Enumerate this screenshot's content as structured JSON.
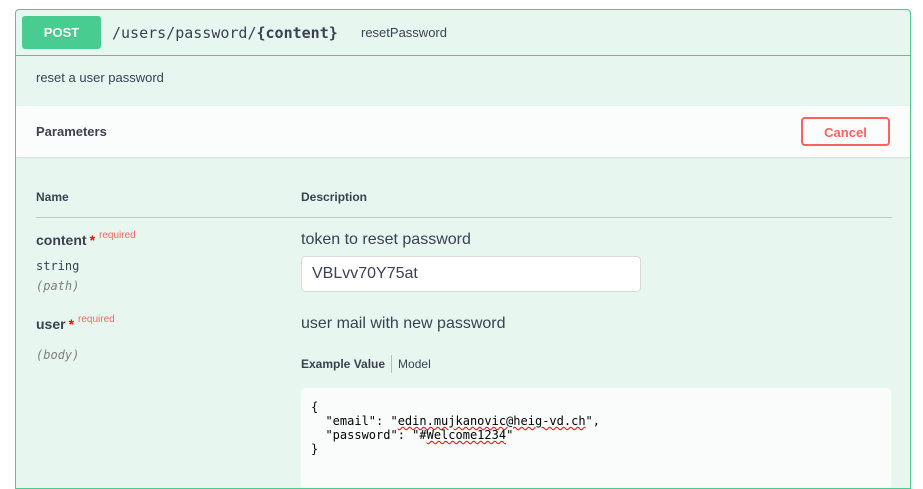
{
  "operation": {
    "method": "POST",
    "path_prefix": "/users/password/",
    "path_param": "{content}",
    "operation_id": "resetPassword",
    "description": "reset a user password"
  },
  "parameters": {
    "title": "Parameters",
    "cancel_label": "Cancel",
    "col_name": "Name",
    "col_description": "Description",
    "items": [
      {
        "name": "content",
        "required_star": "*",
        "required_label": "required",
        "type": "string",
        "in": "(path)",
        "description": "token to reset password",
        "value": "VBLvv70Y75at"
      },
      {
        "name": "user",
        "required_star": "*",
        "required_label": "required",
        "in": "(body)",
        "description": "user mail with new password",
        "tabs": {
          "example_value": "Example Value",
          "model": "Model"
        },
        "example": {
          "open_brace": "{",
          "email_key": "  \"email\": \"",
          "email_value": "edin.mujkanovic@heig-vd.ch",
          "email_end": "\",",
          "password_key": "  \"password\": \"#",
          "password_value": "Welcome1234",
          "password_end": "\"",
          "close_brace": "}"
        }
      }
    ]
  },
  "colors": {
    "post": "#49cc90",
    "cancel": "#ff6060",
    "background": "#e8f6f0"
  }
}
